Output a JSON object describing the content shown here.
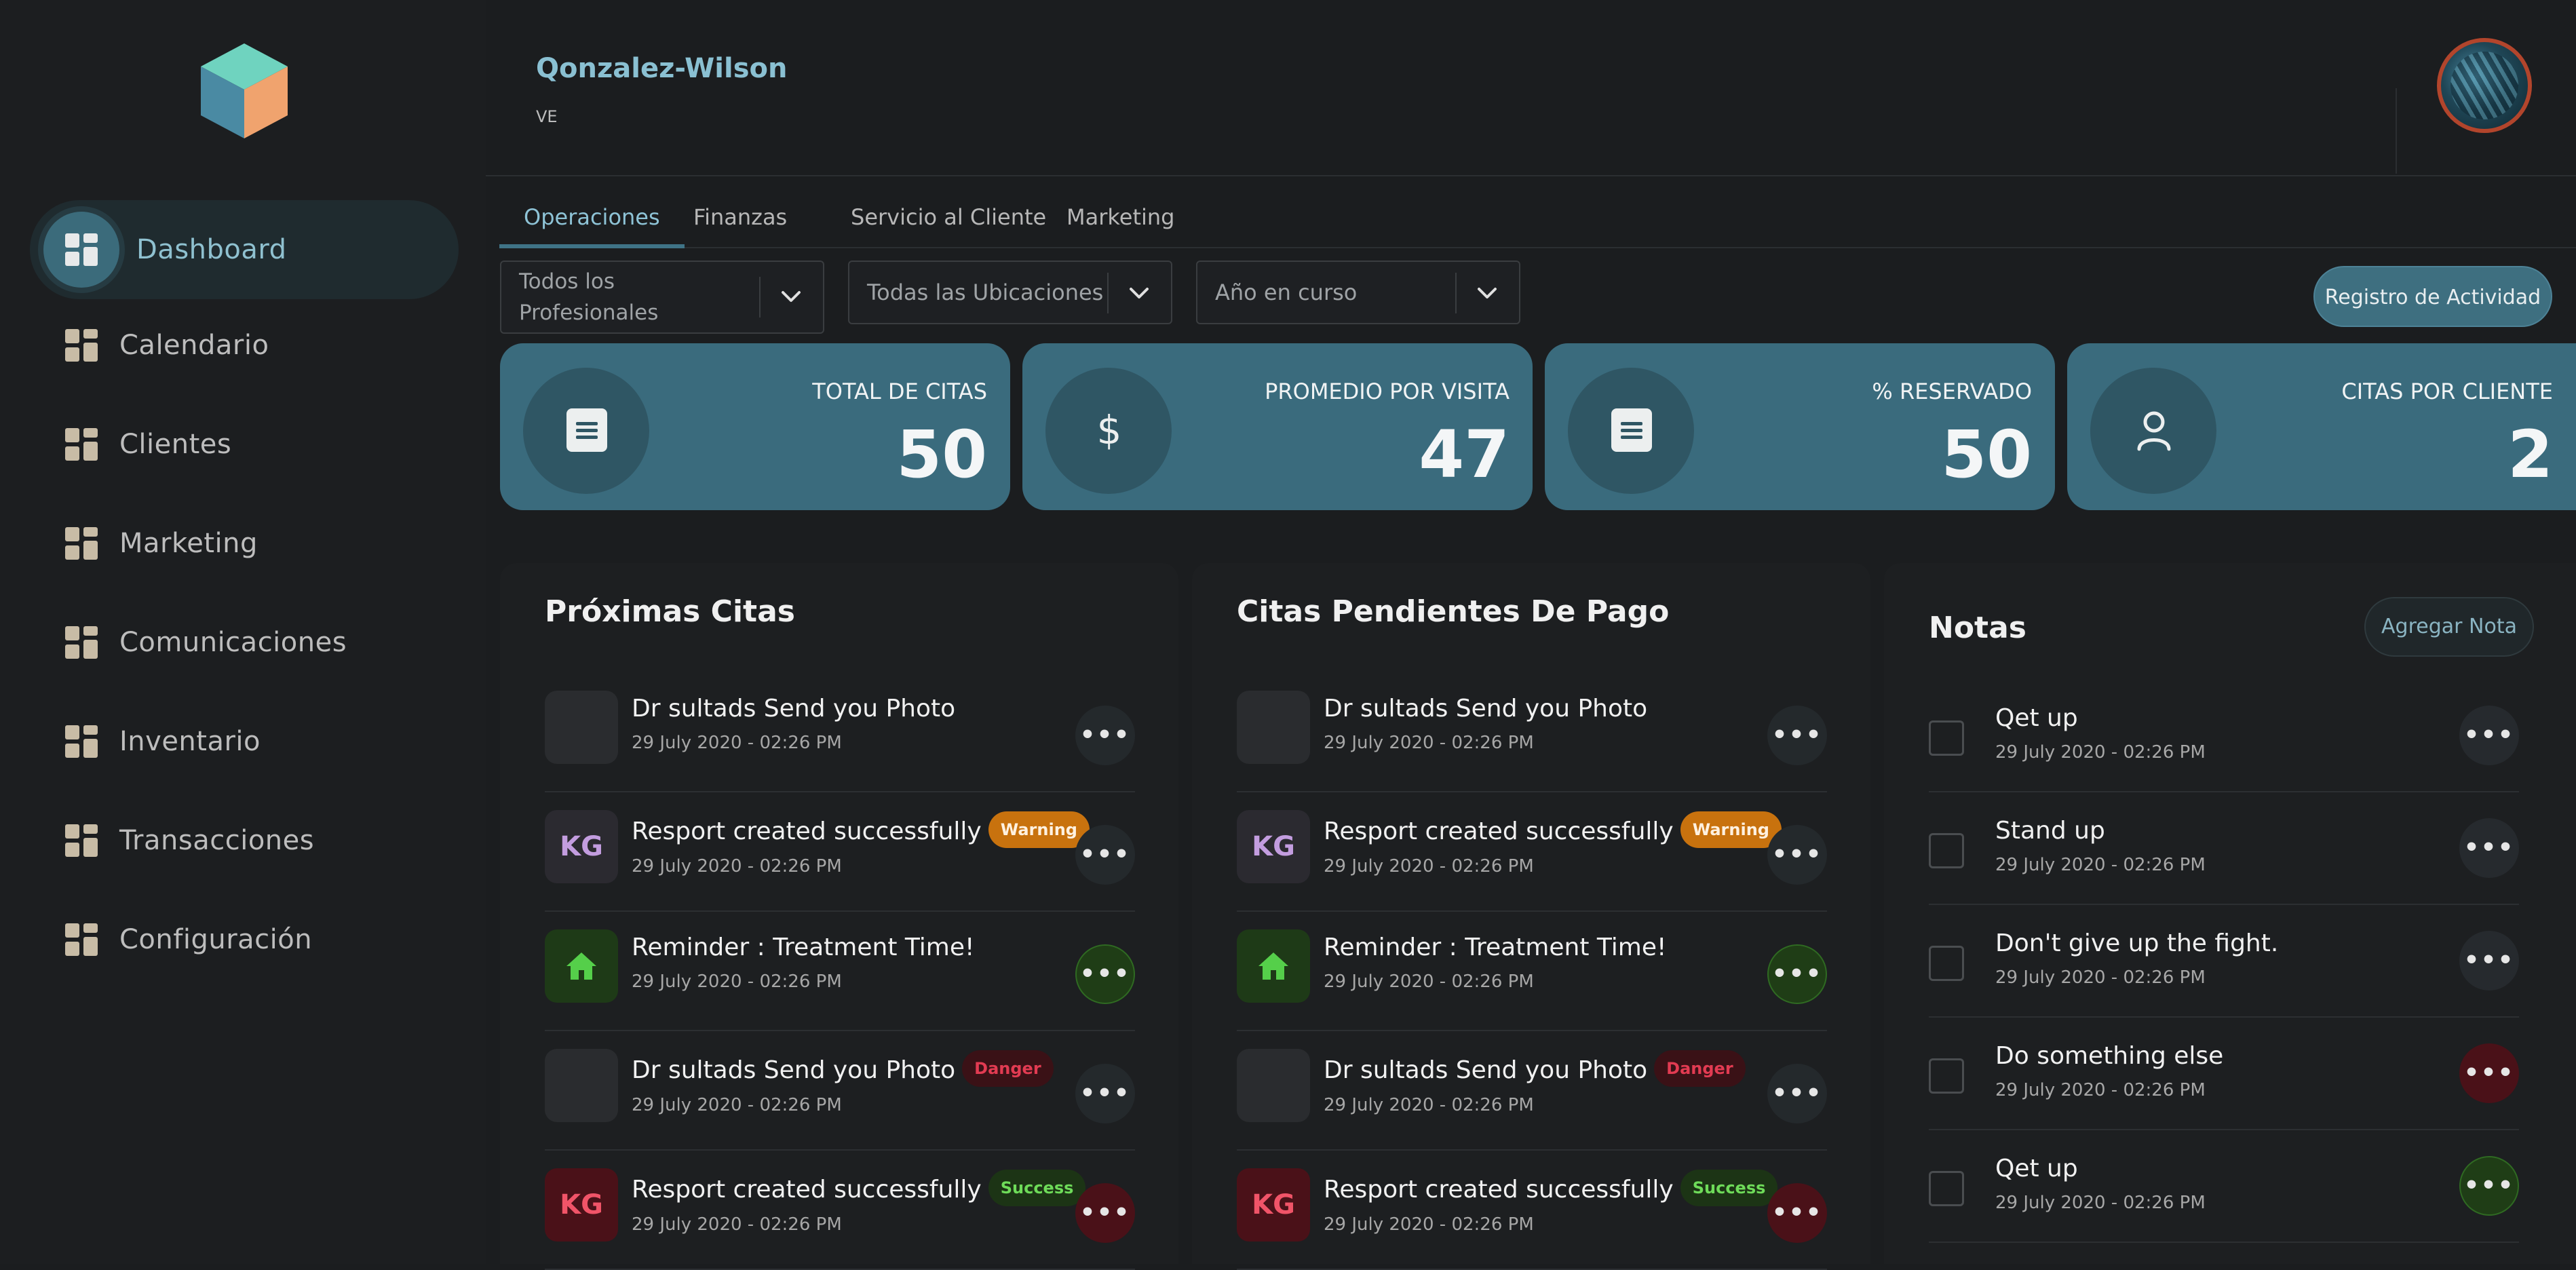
{
  "header": {
    "org_name": "Qonzalez-Wilson",
    "org_code": "VE"
  },
  "sidebar": {
    "items": [
      {
        "label": "Dashboard"
      },
      {
        "label": "Calendario"
      },
      {
        "label": "Clientes"
      },
      {
        "label": "Marketing"
      },
      {
        "label": "Comunicaciones"
      },
      {
        "label": "Inventario"
      },
      {
        "label": "Transacciones"
      },
      {
        "label": "Configuración"
      }
    ]
  },
  "tabs": [
    {
      "label": "Operaciones"
    },
    {
      "label": "Finanzas"
    },
    {
      "label": "Servicio al Cliente"
    },
    {
      "label": "Marketing"
    }
  ],
  "filters": {
    "professionals": "Todos los\nProfesionales",
    "locations": "Todas las Ubicaciones",
    "year": "Año en curso"
  },
  "activity_button": "Registro de Actividad",
  "stats": [
    {
      "label": "TOTAL DE CITAS",
      "value": "50",
      "icon": "document-icon"
    },
    {
      "label": "PROMEDIO POR VISITA",
      "value": "47",
      "icon": "dollar-icon"
    },
    {
      "label": "% RESERVADO",
      "value": "50",
      "icon": "document-icon"
    },
    {
      "label": "CITAS POR CLIENTE",
      "value": "2",
      "icon": "user-icon"
    }
  ],
  "upcoming": {
    "title": "Próximas Citas",
    "items": [
      {
        "title": "Dr sultads Send you Photo",
        "time": "29 July 2020 - 02:26 PM",
        "avatar": "",
        "badge": ""
      },
      {
        "title": "Resport created successfully",
        "time": "29 July 2020 - 02:26 PM",
        "avatar": "KG",
        "badge": "Warning"
      },
      {
        "title": "Reminder : Treatment Time!",
        "time": "29 July 2020 - 02:26 PM",
        "avatar": "home-icon",
        "badge": ""
      },
      {
        "title": "Dr sultads Send you Photo",
        "time": "29 July 2020 - 02:26 PM",
        "avatar": "",
        "badge": "Danger"
      },
      {
        "title": "Resport created successfully",
        "time": "29 July 2020 - 02:26 PM",
        "avatar": "KG",
        "badge": "Success"
      }
    ]
  },
  "pending": {
    "title": "Citas Pendientes De Pago",
    "items": [
      {
        "title": "Dr sultads Send you Photo",
        "time": "29 July 2020 - 02:26 PM",
        "avatar": "",
        "badge": ""
      },
      {
        "title": "Resport created successfully",
        "time": "29 July 2020 - 02:26 PM",
        "avatar": "KG",
        "badge": "Warning"
      },
      {
        "title": "Reminder : Treatment Time!",
        "time": "29 July 2020 - 02:26 PM",
        "avatar": "home-icon",
        "badge": ""
      },
      {
        "title": "Dr sultads Send you Photo",
        "time": "29 July 2020 - 02:26 PM",
        "avatar": "",
        "badge": "Danger"
      },
      {
        "title": "Resport created successfully",
        "time": "29 July 2020 - 02:26 PM",
        "avatar": "KG",
        "badge": "Success"
      }
    ]
  },
  "notes": {
    "title": "Notas",
    "add_label": "Agregar Nota",
    "items": [
      {
        "title": "Qet up",
        "time": "29 July 2020 - 02:26 PM"
      },
      {
        "title": "Stand up",
        "time": "29 July 2020 - 02:26 PM"
      },
      {
        "title": "Don't give up the fight.",
        "time": "29 July 2020 - 02:26 PM"
      },
      {
        "title": "Do something else",
        "time": "29 July 2020 - 02:26 PM"
      },
      {
        "title": "Qet up",
        "time": "29 July 2020 - 02:26 PM"
      }
    ]
  },
  "colors": {
    "accent": "#3a6b7d",
    "warning": "#c8720e",
    "danger": "#4a1118",
    "success": "#1f3d16"
  }
}
